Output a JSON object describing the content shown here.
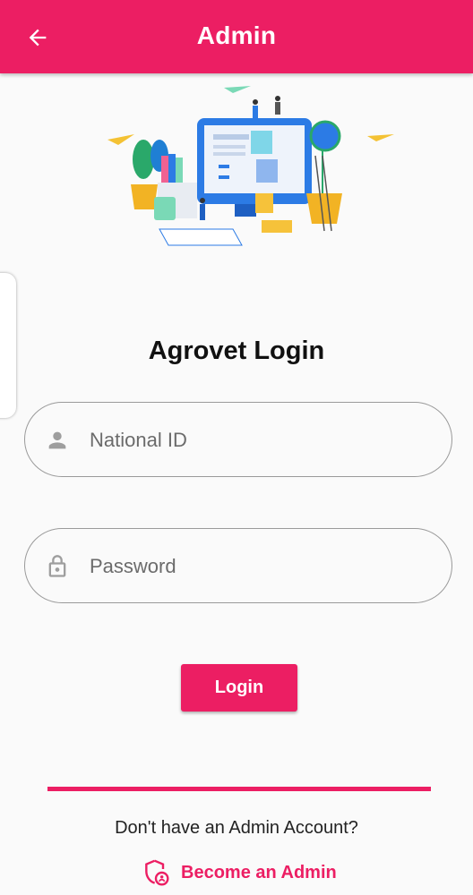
{
  "appbar": {
    "title": "Admin",
    "back_icon": "arrow-left-icon",
    "color": "#ec1e63"
  },
  "illustration": {
    "name": "computer-workspace-illustration"
  },
  "login": {
    "heading": "Agrovet Login",
    "national_id": {
      "placeholder": "National ID",
      "value": "",
      "icon": "person-icon"
    },
    "password": {
      "placeholder": "Password",
      "value": "",
      "icon": "lock-icon"
    },
    "button_label": "Login"
  },
  "footer": {
    "prompt": "Don't have an Admin Account?",
    "become_admin_label": "Become an Admin",
    "become_admin_icon": "admin-shield-icon"
  }
}
